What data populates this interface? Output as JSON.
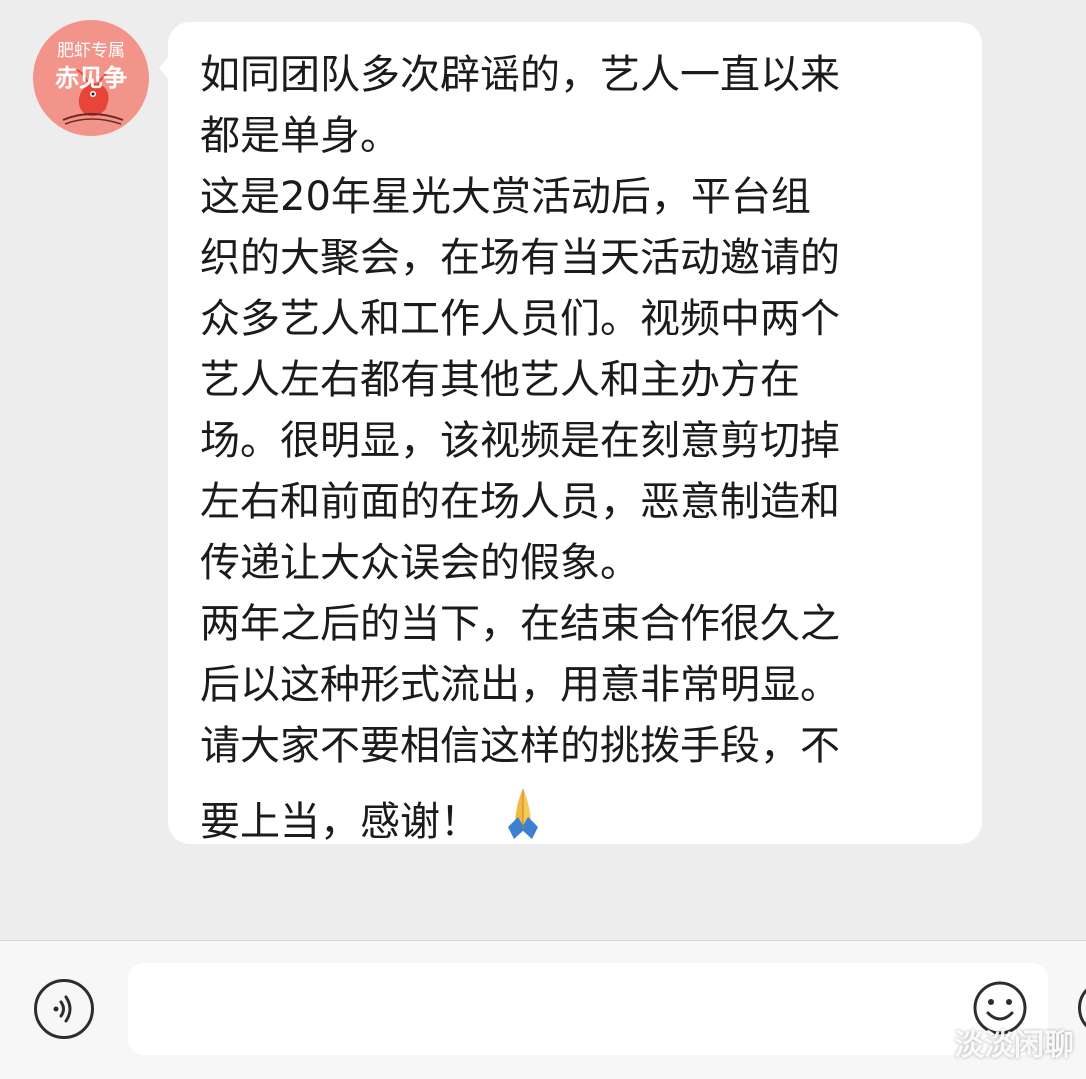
{
  "chat": {
    "sender_avatar": {
      "text_top": "肥虾专属",
      "text_bottom": "赤见争",
      "color": "#f3948a"
    },
    "message": {
      "lines": [
        "如同团队多次辟谣的，艺人一直以来",
        "都是单身。",
        "这是20年星光大赏活动后，平台组",
        "织的大聚会，在场有当天活动邀请的",
        "众多艺人和工作人员们。视频中两个",
        "艺人左右都有其他艺人和主办方在",
        "场。很明显，该视频是在刻意剪切掉",
        "左右和前面的在场人员，恶意制造和",
        "传递让大众误会的假象。",
        "两年之后的当下，在结束合作很久之",
        "后以这种形式流出，用意非常明显。",
        "请大家不要相信这样的挑拨手段，不",
        "要上当，感谢！"
      ],
      "emoji": "folded-hands-icon"
    }
  },
  "input_bar": {
    "voice_icon": "voice-icon",
    "text_value": "",
    "emoji_icon": "smiley-icon",
    "plus_icon": "plus-icon"
  },
  "watermark": "淡淡闲聊",
  "colors": {
    "chat_background": "#ededed",
    "bubble": "#ffffff",
    "input_bar": "#f7f7f7"
  }
}
